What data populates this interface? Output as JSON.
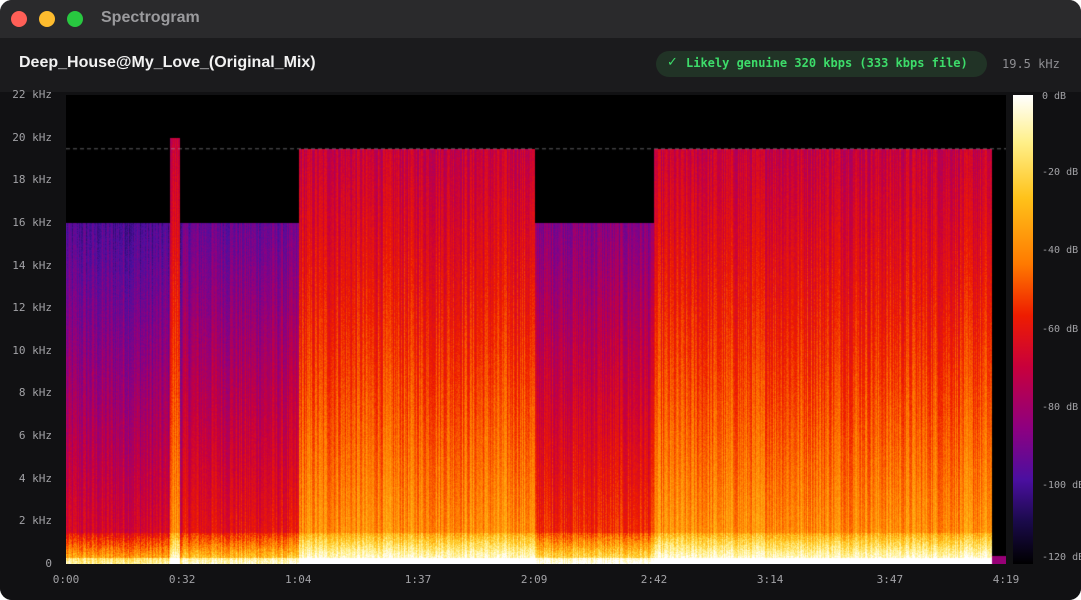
{
  "window": {
    "title": "Spectrogram",
    "traffic_lights": {
      "close": "#ff5f57",
      "minimize": "#febc2e",
      "maximize": "#28c840"
    }
  },
  "header": {
    "file_name": "Deep_House@My_Love_(Original_Mix)",
    "verdict_icon": "checkmark-icon",
    "verdict_check": "✓",
    "verdict": "Likely genuine 320 kbps (333 kbps file)",
    "verdict_color": "#3ddc6a",
    "cutoff": "19.5 kHz"
  },
  "chart_data": {
    "type": "heatmap",
    "title": "",
    "xlabel": "",
    "ylabel": "",
    "x_ticks": [
      "0:00",
      "0:32",
      "1:04",
      "1:37",
      "2:09",
      "2:42",
      "3:14",
      "3:47",
      "4:19"
    ],
    "x_tick_seconds": [
      0,
      32,
      64,
      97,
      129,
      162,
      194,
      227,
      259
    ],
    "xlim_seconds": [
      0,
      259
    ],
    "y_ticks": [
      "22 kHz",
      "20 kHz",
      "18 kHz",
      "16 kHz",
      "14 kHz",
      "12 kHz",
      "10 kHz",
      "8 kHz",
      "6 kHz",
      "4 kHz",
      "2 kHz",
      "0"
    ],
    "y_tick_khz": [
      22,
      20,
      18,
      16,
      14,
      12,
      10,
      8,
      6,
      4,
      2,
      0
    ],
    "ylim_khz": [
      0,
      22
    ],
    "cutoff_line_khz": 19.5,
    "colorbar_ticks": [
      "0 dB",
      "-20 dB",
      "-40 dB",
      "-60 dB",
      "-80 dB",
      "-100 dB",
      "-120 dB"
    ],
    "colorbar_values_db": [
      0,
      -20,
      -40,
      -60,
      -80,
      -100,
      -120
    ],
    "colorbar_range_db": [
      -120,
      0
    ],
    "colormap": [
      "#000000",
      "#1a0a4a",
      "#4b0fa0",
      "#8e0080",
      "#c8003c",
      "#ee1c00",
      "#ff7a00",
      "#ffc21a",
      "#fff08a",
      "#ffffff"
    ],
    "segments": [
      {
        "start_s": 0,
        "end_s": 32,
        "cutoff_khz": 16,
        "level": 0.5
      },
      {
        "start_s": 32,
        "end_s": 64,
        "cutoff_khz": 16,
        "level": 0.55
      },
      {
        "start_s": 64,
        "end_s": 129,
        "cutoff_khz": 19.5,
        "level": 0.72
      },
      {
        "start_s": 129,
        "end_s": 162,
        "cutoff_khz": 16,
        "level": 0.6
      },
      {
        "start_s": 162,
        "end_s": 255,
        "cutoff_khz": 19.5,
        "level": 0.72
      }
    ],
    "transient_s": 30,
    "audio_end_s": 255
  }
}
